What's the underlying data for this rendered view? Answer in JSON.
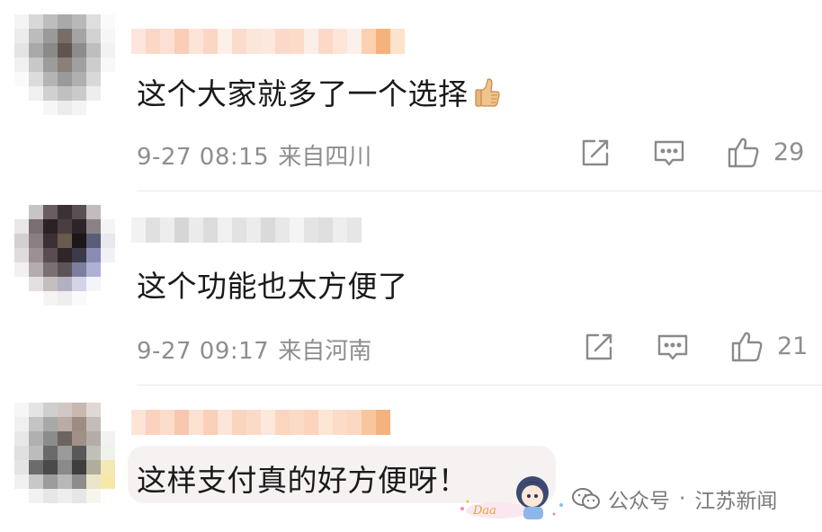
{
  "comments": [
    {
      "text": "这个大家就多了一个选择",
      "emoji": "thumbs-up-emoji",
      "time": "9-27 08:15",
      "location": "来自四川",
      "likes": "29",
      "avatar_colors": [
        "#f4f4f4",
        "#d8d8d8",
        "#bdbdbd",
        "#a9a9a9",
        "#b8b8b8",
        "#dedede",
        "#fafafa",
        "#ececec",
        "#bcbcbc",
        "#9a9a9a",
        "#7a6c66",
        "#a4a4a4",
        "#d2d2d2",
        "#f6f6f6",
        "#e4e4e4",
        "#a8a8a8",
        "#8a8a8a",
        "#5f5551",
        "#8c8c8c",
        "#bebebe",
        "#f2f2f2",
        "#f0f0f0",
        "#c8c8c8",
        "#9c9c9c",
        "#8a7f7a",
        "#a0a0a0",
        "#cdcdcd",
        "#f8f8f8",
        "#fafafa",
        "#dcdcdc",
        "#b4b4b4",
        "#9a9a9a",
        "#b0b0b0",
        "#d8d8d8",
        "#ffffff",
        "#ffffff",
        "#f0f0f0",
        "#d0d0d0",
        "#c0c0c0",
        "#cacaca",
        "#eeeeee",
        "#ffffff",
        "#ffffff",
        "#ffffff",
        "#f6f6f6",
        "#ececec",
        "#f4f4f4",
        "#ffffff",
        "#ffffff"
      ],
      "name_colors": [
        "#fde6dc",
        "#fbd7c6",
        "#fce0d3",
        "#f9cdb8",
        "#fde4d8",
        "#fbd6c4",
        "#fef0e8",
        "#fadbcc",
        "#fce6da",
        "#fde8de",
        "#fbd9c8",
        "#fcdcc9",
        "#fbeee6",
        "#fcd8c6",
        "#fde6d8",
        "#fdf0ea",
        "#fcd0b0",
        "#f6b27a",
        "#fde2cc"
      ]
    },
    {
      "text": "这个功能也太方便了",
      "time": "9-27 09:17",
      "location": "来自河南",
      "likes": "21",
      "avatar_colors": [
        "#ffffff",
        "#c8c4c6",
        "#6a5c60",
        "#3a3234",
        "#5a5052",
        "#c2bcbe",
        "#ffffff",
        "#e8e6e8",
        "#7a6e72",
        "#2a2224",
        "#4a3e40",
        "#2c2428",
        "#8a8286",
        "#f4f4f4",
        "#d4d0d2",
        "#8c7e82",
        "#3c3034",
        "#6a5a4c",
        "#1c1618",
        "#5a5c78",
        "#e8e8ee",
        "#e0dcde",
        "#9c9094",
        "#5a4c50",
        "#2e2628",
        "#3c3a4a",
        "#8a8cb4",
        "#f0f0f6",
        "#f2f0f2",
        "#b4acb0",
        "#7a7074",
        "#5c5458",
        "#7c7e9e",
        "#aeb0d4",
        "#ffffff",
        "#ffffff",
        "#e4e0e2",
        "#c4bec0",
        "#b4b0c0",
        "#d4d4e8",
        "#f4f4fa",
        "#ffffff",
        "#ffffff",
        "#ffffff",
        "#f4f4f4",
        "#eeeeee",
        "#fafafa",
        "#ffffff",
        "#ffffff"
      ],
      "name_colors": [
        "#f2f2f2",
        "#e0e0e0",
        "#ededed",
        "#d6d6d6",
        "#ebebeb",
        "#dcdcdc",
        "#f0f0f0",
        "#e2e2e2",
        "#ececec",
        "#dadada",
        "#e8e8e8",
        "#f4f4f4",
        "#e4e4e4",
        "#dedede",
        "#eeeeee",
        "#e6e6e6"
      ]
    },
    {
      "text": "这样支付真的好方便呀！",
      "avatar_colors": [
        "#f6f6f6",
        "#e4e4e4",
        "#cfcfcf",
        "#d0c8c4",
        "#c8b8b0",
        "#e0d8d4",
        "#ffffff",
        "#f0f0f0",
        "#c4c4c4",
        "#a8a8a8",
        "#b8aca4",
        "#9c8c84",
        "#c4bcb8",
        "#ffffff",
        "#e8e8e8",
        "#b0b0b0",
        "#8c8c8c",
        "#6c6460",
        "#a09088",
        "#b4aca8",
        "#f2f2f2",
        "#e0e0e0",
        "#bcbcbc",
        "#6a6a6a",
        "#9a9a9a",
        "#585858",
        "#c0c0b8",
        "#eef2ea",
        "#e4e4e4",
        "#6c6c6c",
        "#4a4a4a",
        "#8a8a8a",
        "#3e3e3e",
        "#b0ad9c",
        "#f4e8b4",
        "#f0f0f0",
        "#c8c8c8",
        "#9c9c9c",
        "#b8b8b8",
        "#8c8c8c",
        "#eae6cc",
        "#f8e8a8",
        "#ffffff",
        "#f2f2f2",
        "#e6e6e6",
        "#eeeeee",
        "#e6e6e6",
        "#f8f6ec",
        "#ffffff"
      ],
      "name_colors": [
        "#fde4d6",
        "#fbd2bd",
        "#fcdccb",
        "#f8c8ae",
        "#fde2d2",
        "#fad0b8",
        "#fce6da",
        "#f9d4be",
        "#fcdac8",
        "#fde8dc",
        "#fad6c0",
        "#fbdbc6",
        "#fcd4bc",
        "#fde6d6",
        "#fbdcc8",
        "#fcd8c2",
        "#f8c69c",
        "#f4b27e"
      ]
    }
  ],
  "watermark": {
    "source": "公众号",
    "separator": "·",
    "account": "江苏新闻"
  },
  "colors": {
    "text_primary": "#1a1a1a",
    "text_secondary": "#8e8e8e",
    "icon": "#8a8a8a",
    "divider": "#e9e9e9"
  }
}
